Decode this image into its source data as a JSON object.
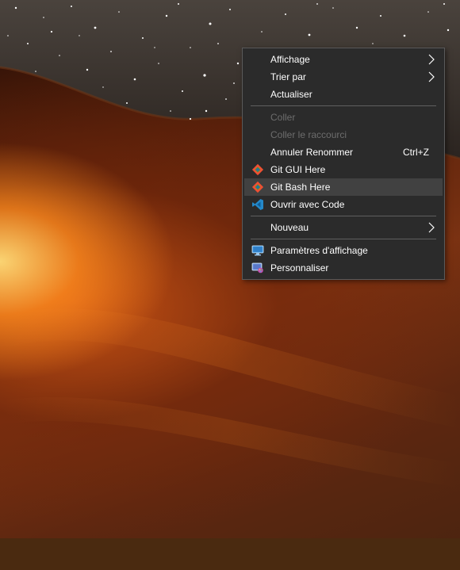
{
  "menu": {
    "items": [
      {
        "label": "Affichage",
        "has_submenu": true
      },
      {
        "label": "Trier par",
        "has_submenu": true
      },
      {
        "label": "Actualiser"
      },
      {
        "label": "Coller",
        "disabled": true
      },
      {
        "label": "Coller le raccourci",
        "disabled": true
      },
      {
        "label": "Annuler Renommer",
        "shortcut": "Ctrl+Z"
      },
      {
        "label": "Git GUI Here",
        "icon": "git-icon"
      },
      {
        "label": "Git Bash Here",
        "icon": "git-icon",
        "highlighted": true
      },
      {
        "label": "Ouvrir avec Code",
        "icon": "vscode-icon"
      },
      {
        "label": "Nouveau",
        "has_submenu": true
      },
      {
        "label": "Paramètres d'affichage",
        "icon": "display-settings-icon"
      },
      {
        "label": "Personnaliser",
        "icon": "personalize-icon"
      }
    ]
  },
  "colors": {
    "menu_bg": "#2b2b2b",
    "menu_border": "#5a5a5a",
    "highlight": "#414141",
    "text": "#ffffff",
    "disabled_text": "#6d6d6d",
    "git_orange": "#f05033",
    "vscode_blue": "#2489ca"
  }
}
